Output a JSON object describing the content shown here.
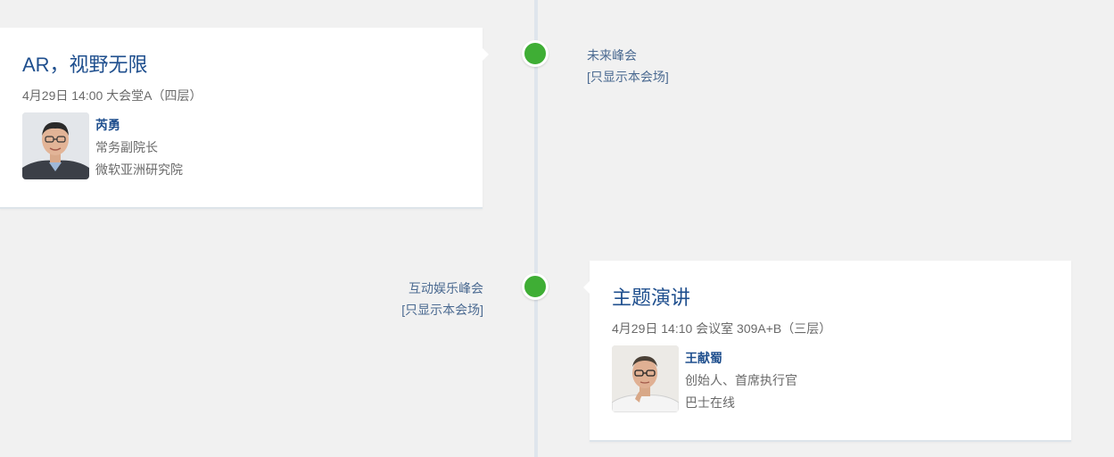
{
  "timeline": {
    "events": [
      {
        "title": "AR，视野无限",
        "meta": "4月29日 14:00 大会堂A（四层）",
        "speaker": {
          "name": "芮勇",
          "role": "常务副院长",
          "org": "微软亚洲研究院"
        },
        "venue": {
          "name": "未来峰会",
          "filter_link": "[只显示本会场]"
        }
      },
      {
        "title": "主题演讲",
        "meta": "4月29日 14:10 会议室 309A+B（三层）",
        "speaker": {
          "name": "王献蜀",
          "role": "创始人、首席执行官",
          "org": "巴士在线"
        },
        "venue": {
          "name": "互动娱乐峰会",
          "filter_link": "[只显示本会场]"
        }
      }
    ]
  },
  "colors": {
    "accent_blue": "#1f4f8e",
    "node_green": "#3fae35",
    "background": "#f1f1f1"
  }
}
